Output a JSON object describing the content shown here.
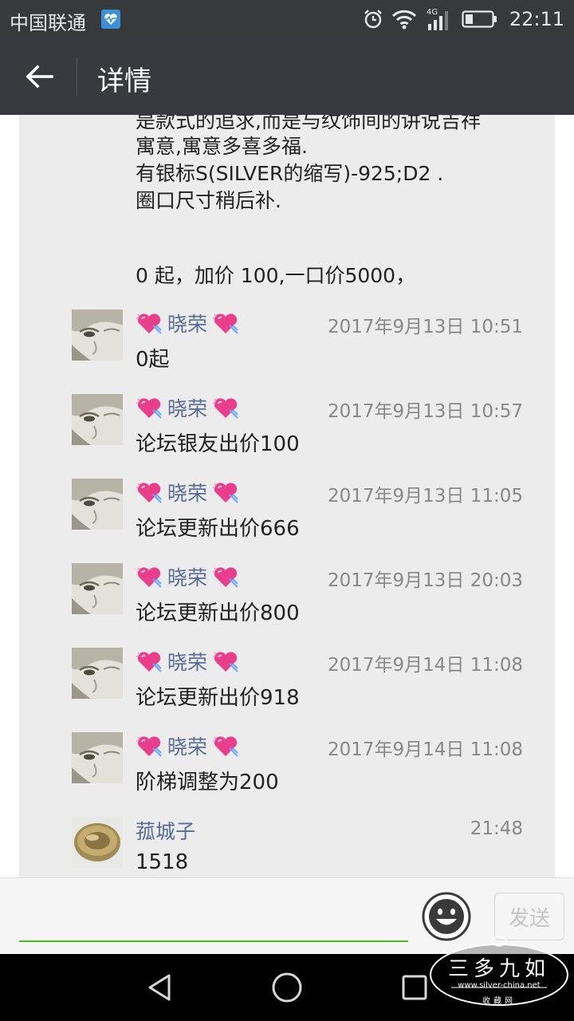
{
  "status_bar": {
    "carrier": "中国联通",
    "network": "4G",
    "time": "22:11"
  },
  "app_bar": {
    "title": "详情"
  },
  "post": {
    "lines": [
      "是款式的追求,而是与纹饰间的讲说吉祥",
      "寓意,寓意多喜多福.",
      "有银标S(SILVER的缩写)-925;D2 .",
      "圈口尺寸稍后补.",
      "0 起，加价 100,一口价5000，"
    ]
  },
  "comments": [
    {
      "name": "晓荣",
      "time": "2017年9月13日 10:51",
      "text": "0起",
      "avatar_icon": "face-avatar",
      "decorated": true
    },
    {
      "name": "晓荣",
      "time": "2017年9月13日 10:57",
      "text": "论坛银友出价100",
      "avatar_icon": "face-avatar",
      "decorated": true
    },
    {
      "name": "晓荣",
      "time": "2017年9月13日 11:05",
      "text": "论坛更新出价666",
      "avatar_icon": "face-avatar",
      "decorated": true
    },
    {
      "name": "晓荣",
      "time": "2017年9月13日 20:03",
      "text": "论坛更新出价800",
      "avatar_icon": "face-avatar",
      "decorated": true
    },
    {
      "name": "晓荣",
      "time": "2017年9月14日 11:08",
      "text": "论坛更新出价918",
      "avatar_icon": "face-avatar",
      "decorated": true
    },
    {
      "name": "晓荣",
      "time": "2017年9月14日 11:08",
      "text": "阶梯调整为200",
      "avatar_icon": "face-avatar",
      "decorated": true
    },
    {
      "name": "菰城子",
      "time": "21:48",
      "text": "1518",
      "avatar_icon": "coin-avatar",
      "decorated": false
    }
  ],
  "input_bar": {
    "placeholder": "",
    "send_label": "发送"
  },
  "watermark": {
    "main": "三多九如",
    "url": "www.silver-china.net",
    "sub": "收藏网"
  },
  "colors": {
    "accent_green": "#45c01a",
    "name_blue": "#576b95",
    "app_bar": "#393a3f",
    "heart_pink": "#e83e8c"
  }
}
